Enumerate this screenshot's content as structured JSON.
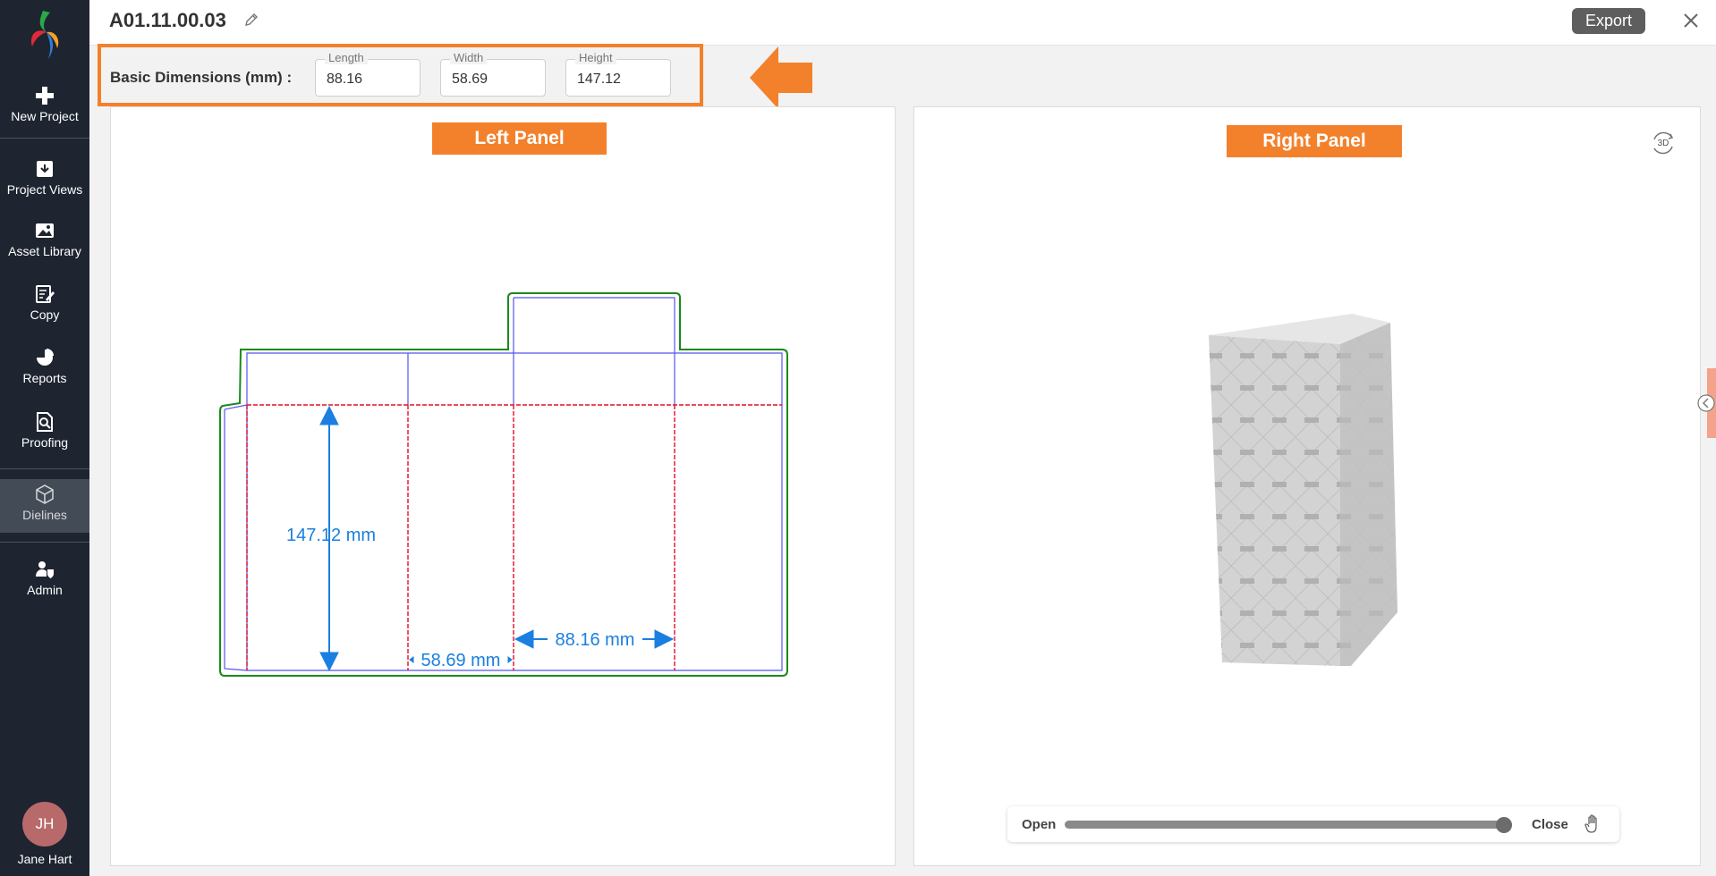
{
  "app": {
    "title": "A01.11.00.03",
    "export_label": "Export"
  },
  "sidebar": {
    "items": [
      {
        "label": "New Project",
        "icon": "plus-icon"
      },
      {
        "label": "Project Views",
        "icon": "inbox-download-icon"
      },
      {
        "label": "Asset Library",
        "icon": "image-icon"
      },
      {
        "label": "Copy",
        "icon": "edit-document-icon"
      },
      {
        "label": "Reports",
        "icon": "pie-chart-icon"
      },
      {
        "label": "Proofing",
        "icon": "document-search-icon"
      },
      {
        "label": "Dielines",
        "icon": "box-icon",
        "active": true
      },
      {
        "label": "Admin",
        "icon": "user-shield-icon"
      }
    ],
    "user": {
      "initials": "JH",
      "name": "Jane Hart"
    }
  },
  "dimensions": {
    "label": "Basic Dimensions (mm) :",
    "length": {
      "label": "Length",
      "value": "88.16"
    },
    "width": {
      "label": "Width",
      "value": "58.69"
    },
    "height": {
      "label": "Height",
      "value": "147.12"
    }
  },
  "panels": {
    "left_label": "Left Panel",
    "right_label": "Right Panel"
  },
  "dieline": {
    "height_label": "147.12 mm",
    "width_label": "58.69 mm",
    "length_label": "88.16 mm"
  },
  "viewer": {
    "badge": "3D",
    "open_label": "Open",
    "close_label": "Close",
    "slider_value": 1.0
  },
  "colors": {
    "accent": "#f3812c",
    "sidebar_bg": "#1e2530",
    "dieline_cut": "#1a8a1a",
    "dieline_fold": "#5555ee",
    "dieline_bleed": "#e0102a",
    "dimension": "#1a7fe0"
  }
}
